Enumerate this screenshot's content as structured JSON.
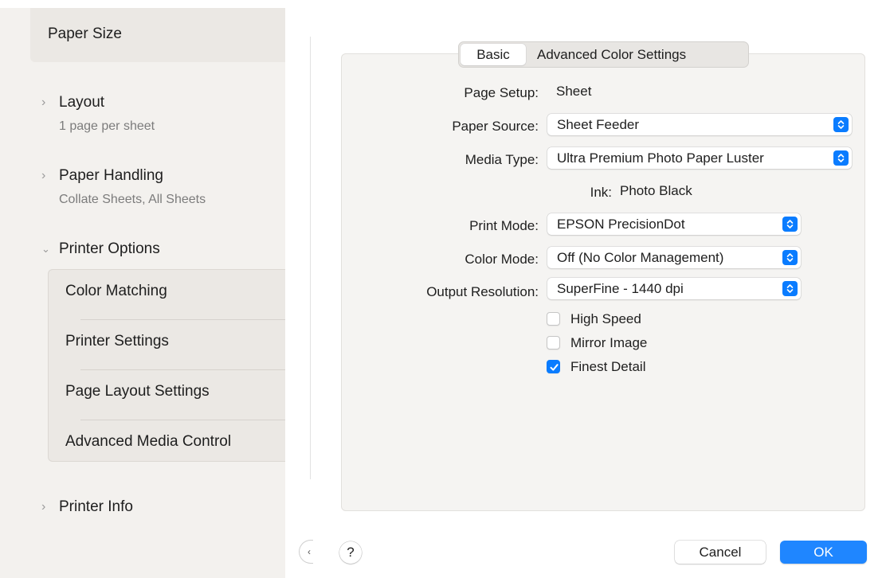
{
  "sidebar": {
    "paper_size": "Paper Size",
    "layout": {
      "title": "Layout",
      "subtitle": "1 page per sheet"
    },
    "paper_handling": {
      "title": "Paper Handling",
      "subtitle": "Collate Sheets, All Sheets"
    },
    "printer_options": {
      "title": "Printer Options",
      "items": [
        "Color Matching",
        "Printer Settings",
        "Page Layout Settings",
        "Advanced Media Control"
      ]
    },
    "printer_info": "Printer Info"
  },
  "tabs": {
    "basic": "Basic",
    "advanced": "Advanced Color Settings"
  },
  "settings": {
    "page_setup": {
      "label": "Page Setup:",
      "value": "Sheet"
    },
    "paper_source": {
      "label": "Paper Source:",
      "value": "Sheet Feeder"
    },
    "media_type": {
      "label": "Media Type:",
      "value": "Ultra Premium Photo Paper Luster"
    },
    "ink": {
      "label": "Ink:",
      "value": "Photo Black"
    },
    "print_mode": {
      "label": "Print Mode:",
      "value": "EPSON PrecisionDot"
    },
    "color_mode": {
      "label": "Color Mode:",
      "value": "Off (No Color Management)"
    },
    "output_resolution": {
      "label": "Output Resolution:",
      "value": "SuperFine - 1440 dpi"
    },
    "high_speed": {
      "label": "High Speed",
      "checked": false
    },
    "mirror_image": {
      "label": "Mirror Image",
      "checked": false
    },
    "finest_detail": {
      "label": "Finest Detail",
      "checked": true
    }
  },
  "buttons": {
    "help": "?",
    "cancel": "Cancel",
    "ok": "OK"
  },
  "colors": {
    "accent": "#0a7cff",
    "ok_button": "#1f86ff",
    "sidebar_bg": "#f3f1ee"
  }
}
